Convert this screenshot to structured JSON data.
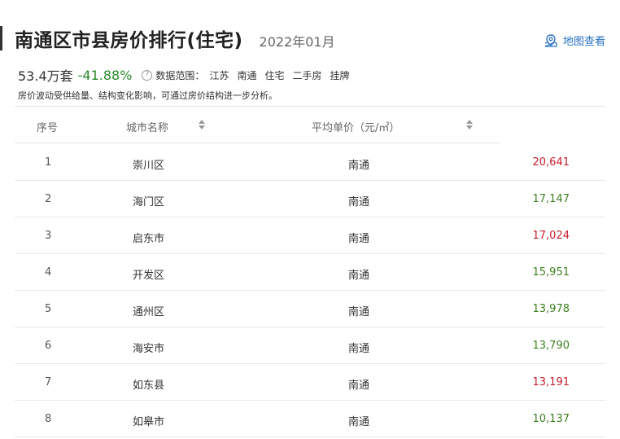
{
  "header": {
    "title": "南通区市县房价排行(住宅)",
    "period": "2022年01月",
    "map_link": "地图查看"
  },
  "stats": {
    "count": "53.4万套",
    "change": "-41.88%",
    "help_glyph": "?",
    "scope_label": "数据范围：",
    "scope_items": [
      "江苏",
      "南通",
      "住宅",
      "二手房",
      "挂牌"
    ]
  },
  "note": "房价波动受供给量、结构变化影响，可通过房价结构进一步分析。",
  "table": {
    "headers": {
      "rank": "序号",
      "city": "城市名称",
      "price": "平均单价（元/㎡）"
    },
    "rows": [
      {
        "rank": "1",
        "city": "崇川区",
        "region": "南通",
        "price": "20,641",
        "trend": "up"
      },
      {
        "rank": "2",
        "city": "海门区",
        "region": "南通",
        "price": "17,147",
        "trend": "down"
      },
      {
        "rank": "3",
        "city": "启东市",
        "region": "南通",
        "price": "17,024",
        "trend": "up"
      },
      {
        "rank": "4",
        "city": "开发区",
        "region": "南通",
        "price": "15,951",
        "trend": "down"
      },
      {
        "rank": "5",
        "city": "通州区",
        "region": "南通",
        "price": "13,978",
        "trend": "down"
      },
      {
        "rank": "6",
        "city": "海安市",
        "region": "南通",
        "price": "13,790",
        "trend": "down"
      },
      {
        "rank": "7",
        "city": "如东县",
        "region": "南通",
        "price": "13,191",
        "trend": "up"
      },
      {
        "rank": "8",
        "city": "如皋市",
        "region": "南通",
        "price": "10,137",
        "trend": "down"
      }
    ]
  },
  "colors": {
    "up": "#c8202e",
    "down": "#3f7f1f",
    "link": "#2a72c6"
  },
  "icons": {
    "map": "map-pin-icon",
    "help": "question-circle-icon",
    "sort": "sort-arrows-icon"
  }
}
